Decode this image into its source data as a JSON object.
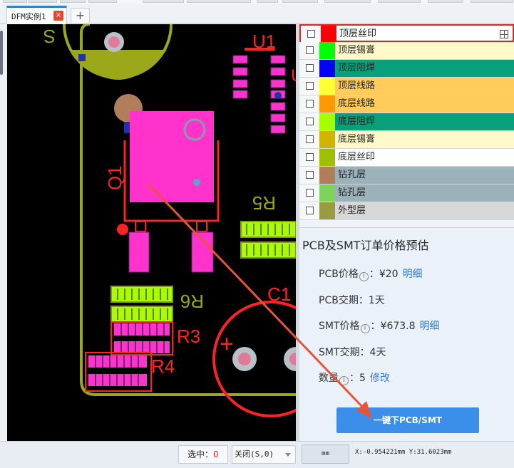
{
  "tabs": [
    {
      "label": "DFM实例1",
      "close_glyph": "×"
    }
  ],
  "add_tab_glyph": "+",
  "canvas": {
    "labels": {
      "u1": "U1",
      "q1": "Q1",
      "r5": "R5",
      "r6": "R6",
      "r3": "R3",
      "r4": "R4",
      "c1": "C1",
      "plus": "+",
      "corner": "S"
    }
  },
  "layers": [
    {
      "name": "顶层丝印",
      "color": "#ff0000",
      "row_bg": "#ffffff",
      "active": true
    },
    {
      "name": "顶层锡膏",
      "color": "#00ff00",
      "row_bg": "#fff8c8",
      "active": false
    },
    {
      "name": "顶层阻焊",
      "color": "#0000ff",
      "row_bg": "#07a07a",
      "active": false
    },
    {
      "name": "顶层线路",
      "color": "#ffff33",
      "row_bg": "#ffcb5a",
      "active": false
    },
    {
      "name": "底层线路",
      "color": "#ff9900",
      "row_bg": "#ffcb5a",
      "active": false
    },
    {
      "name": "底层阻焊",
      "color": "#a6ff00",
      "row_bg": "#07a07a",
      "active": false
    },
    {
      "name": "底层锡膏",
      "color": "#cfb400",
      "row_bg": "#fff8c8",
      "active": false
    },
    {
      "name": "底层丝印",
      "color": "#9fbf00",
      "row_bg": "#ffffff",
      "active": false
    },
    {
      "name": "钻孔层",
      "color": "#b07e5a",
      "row_bg": "#9bb2bb",
      "active": false
    },
    {
      "name": "钻孔层",
      "color": "#7ed35a",
      "row_bg": "#9bb2bb",
      "active": false
    },
    {
      "name": "外型层",
      "color": "#9a9a40",
      "row_bg": "#d7d7d7",
      "active": false
    }
  ],
  "price": {
    "title": "PCB及SMT订单价格预估",
    "pcb_price_label": "PCB价格",
    "pcb_price_value": "¥20",
    "pcb_price_link": "明细",
    "pcb_lead_label": "PCB交期",
    "pcb_lead_value": "1天",
    "smt_price_label": "SMT价格",
    "smt_price_value": "¥673.8",
    "smt_price_link": "明细",
    "smt_lead_label": "SMT交期",
    "smt_lead_value": "4天",
    "qty_label": "数量",
    "qty_value": "5",
    "qty_link": "修改",
    "info_glyph": "i",
    "colon": "：",
    "order_button": "一键下PCB/SMT"
  },
  "status": {
    "selected_label": "选中：",
    "selected_count": "0",
    "snap_value": "关闭(S,0)",
    "unit": "mm",
    "coords": "X:-0.954221mm Y:31.6023mm"
  },
  "colors": {
    "accent_blue": "#3b8fe8",
    "active_border": "#d6252b",
    "top_silk": "#ff0000",
    "pad_magenta": "#ff33cc",
    "outline_olive": "#9aa81a",
    "paste_green": "#a6ff00",
    "annotation_arrow": "#e8543a"
  }
}
